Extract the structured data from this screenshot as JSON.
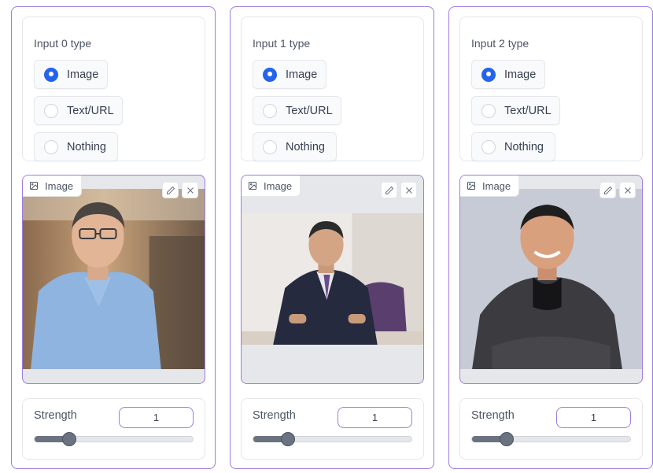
{
  "columns": [
    {
      "type_label": "Input 0 type",
      "options": [
        "Image",
        "Text/URL",
        "Nothing"
      ],
      "selected": "Image",
      "image_badge": "Image",
      "strength_label": "Strength",
      "strength_value": "1",
      "strength_slider_level": 0.22
    },
    {
      "type_label": "Input 1 type",
      "options": [
        "Image",
        "Text/URL",
        "Nothing"
      ],
      "selected": "Image",
      "image_badge": "Image",
      "strength_label": "Strength",
      "strength_value": "1",
      "strength_slider_level": 0.22
    },
    {
      "type_label": "Input 2 type",
      "options": [
        "Image",
        "Text/URL",
        "Nothing"
      ],
      "selected": "Image",
      "image_badge": "Image",
      "strength_label": "Strength",
      "strength_value": "1",
      "strength_slider_level": 0.22
    }
  ],
  "colors": {
    "accent_border": "#9f7be0",
    "radio_checked": "#2563eb",
    "slider": "#6b7280"
  },
  "icons": {
    "badge": "image-icon",
    "edit": "pencil-icon",
    "clear": "close-icon"
  }
}
